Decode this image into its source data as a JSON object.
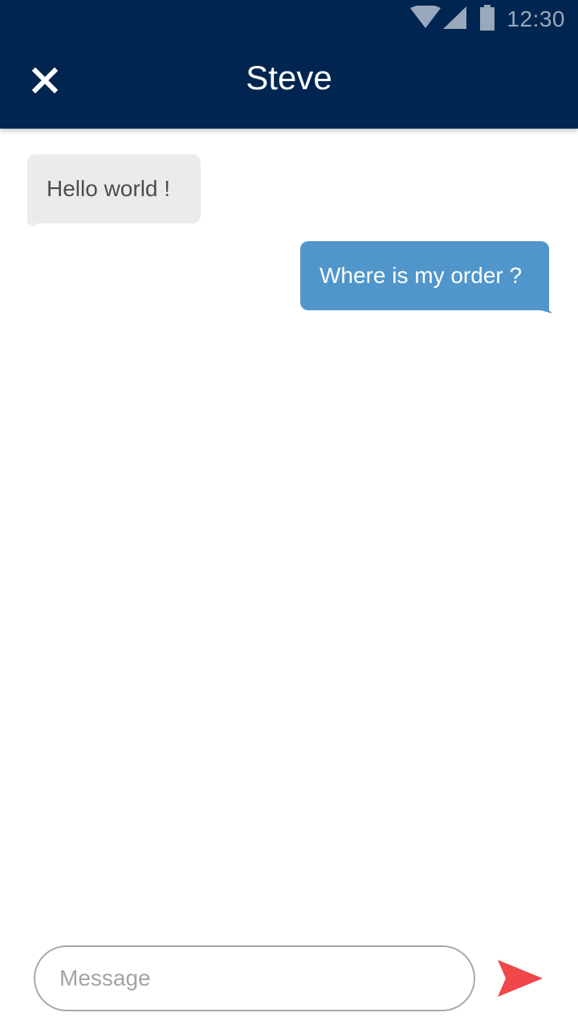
{
  "status_bar": {
    "time": "12:30",
    "icons": [
      "wifi-icon",
      "signal-icon",
      "battery-icon"
    ]
  },
  "header": {
    "title": "Steve",
    "close_icon": "close-icon"
  },
  "messages": [
    {
      "direction": "incoming",
      "text": "Hello world !"
    },
    {
      "direction": "outgoing",
      "text": "Where is my order ?"
    }
  ],
  "composer": {
    "placeholder": "Message",
    "value": "",
    "send_icon": "send-icon"
  },
  "colors": {
    "header_bg": "#002550",
    "incoming_bubble": "#ebebeb",
    "outgoing_bubble": "#5196cb",
    "send_accent": "#f0474a"
  }
}
